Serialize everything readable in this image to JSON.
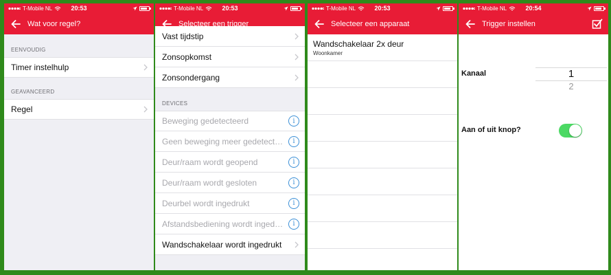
{
  "status_bars": [
    {
      "carrier": "T-Mobile NL",
      "time": "20:53"
    },
    {
      "carrier": "T-Mobile NL",
      "time": "20:53"
    },
    {
      "carrier": "T-Mobile NL",
      "time": "20:53"
    },
    {
      "carrier": "T-Mobile NL",
      "time": "20:54"
    }
  ],
  "screen1": {
    "title": "Wat voor regel?",
    "sections": [
      {
        "header": "EENVOUDIG",
        "items": [
          "Timer instelhulp"
        ]
      },
      {
        "header": "GEAVANCEERD",
        "items": [
          "Regel"
        ]
      }
    ]
  },
  "screen2": {
    "title": "Selecteer een trigger",
    "time_items": [
      "Vast tijdstip",
      "Zonsopkomst",
      "Zonsondergang"
    ],
    "devices_header": "DEVICES",
    "device_items": [
      "Beweging gedetecteerd",
      "Geen beweging meer gedetecteerd",
      "Deur/raam wordt geopend",
      "Deur/raam wordt gesloten",
      "Deurbel wordt ingedrukt",
      "Afstandsbediening wordt ingedrukt"
    ],
    "active_item": "Wandschakelaar wordt ingedrukt",
    "info_glyph": "i"
  },
  "screen3": {
    "title": "Selecteer een apparaat",
    "device": {
      "name": "Wandschakelaar 2x deur",
      "room": "Woonkamer"
    }
  },
  "screen4": {
    "title": "Trigger instellen",
    "channel_label": "Kanaal",
    "channel_selected": "1",
    "channel_next": "2",
    "toggle_label": "Aan of uit knop?",
    "toggle_on": true
  },
  "colors": {
    "brand_red": "#e81c36",
    "frame_green": "#2f8a1b",
    "info_blue": "#3b8fd6",
    "toggle_green": "#4cd964"
  },
  "icons": {
    "back": "arrow-left-icon",
    "chevron": "chevron-right-icon",
    "info": "info-icon",
    "save": "checkbox-check-icon"
  }
}
